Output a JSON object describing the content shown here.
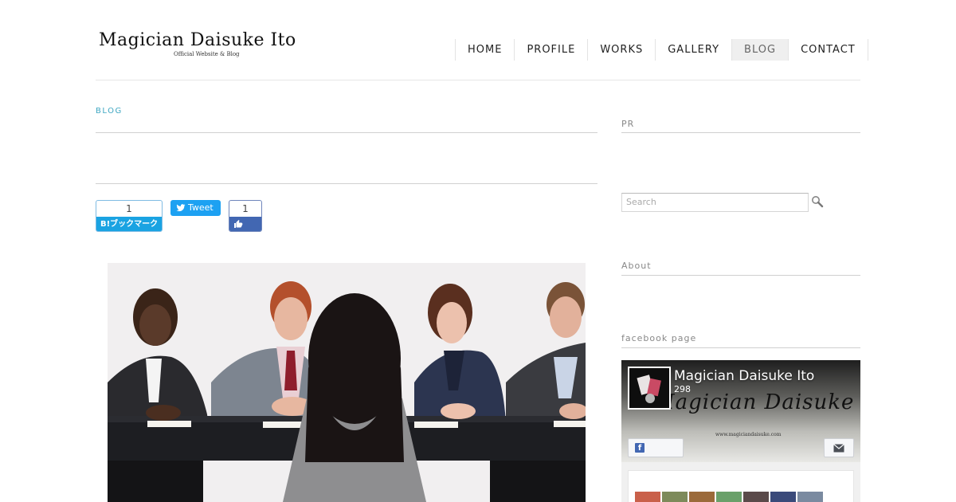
{
  "header": {
    "logo_title": "Magician Daisuke Ito",
    "logo_subtitle": "Official Website & Blog"
  },
  "nav": {
    "items": [
      {
        "label": "HOME"
      },
      {
        "label": "PROFILE"
      },
      {
        "label": "WORKS"
      },
      {
        "label": "GALLERY"
      },
      {
        "label": "BLOG",
        "active": true
      },
      {
        "label": "CONTACT"
      }
    ]
  },
  "main": {
    "breadcrumb": "BLOG",
    "share": {
      "hatena_count": "1",
      "hatena_label": "B!ブックマーク",
      "tweet_label": "Tweet",
      "like_count": "1"
    }
  },
  "sidebar": {
    "pr_heading": "PR",
    "search_placeholder": "Search",
    "about_heading": "About",
    "facebook_heading": "facebook page",
    "facebook": {
      "page_name": "Magician Daisuke Ito",
      "likes": "298",
      "cover_text": "Magician Daisuke Ito",
      "cover_url": "www.magiciandaisuke.com"
    }
  },
  "colors": {
    "accent": "#3fa7c2",
    "hatena": "#1aa3e2",
    "twitter": "#1da1f2",
    "facebook": "#4267b2",
    "nav_active_bg": "#efefef"
  },
  "icons": [
    "search-icon",
    "twitter-bird-icon",
    "thumbs-up-icon",
    "facebook-f-icon",
    "envelope-icon"
  ]
}
